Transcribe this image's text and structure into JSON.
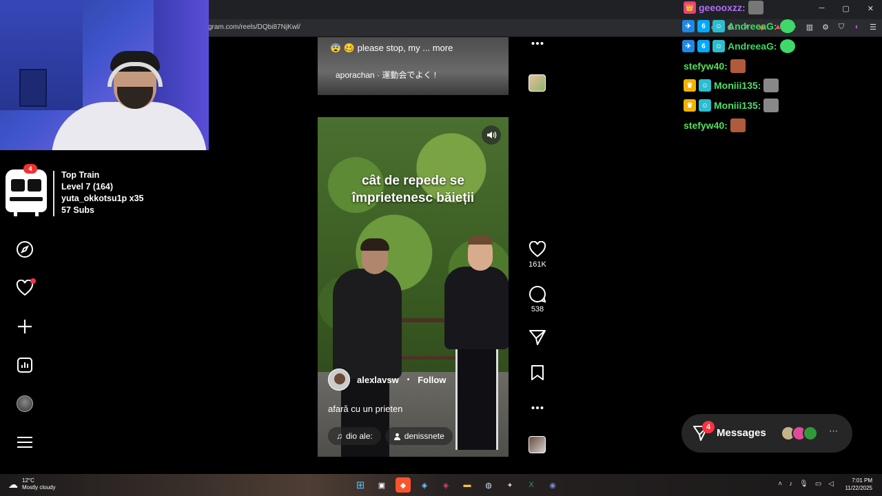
{
  "browser": {
    "url": "gram.com/reels/DQbi87NjKwl/"
  },
  "streamer_widget": {
    "title": "Top Train",
    "level": "Level 7  (164)",
    "top_user": "yuta_okkotsu1p x35",
    "subs": "57 Subs",
    "badge": "4"
  },
  "sidebar": {
    "items": [
      "explore-icon",
      "notifications-icon",
      "create-icon",
      "dashboard-icon",
      "profile-icon",
      "menu-icon"
    ]
  },
  "prev_reel": {
    "caption": "😨 🥴 please stop, my ... more",
    "music": "aporachan · 運動会でよく !"
  },
  "reel": {
    "headline_line1": "cât de repede se",
    "headline_line2": "împrietenesc băieții",
    "author": "alexlavsw",
    "follow": "Follow",
    "caption": "afară cu un prieten",
    "music": "dio  ale:",
    "tagged": "denissnete"
  },
  "actions": {
    "likes": "161K",
    "comments": "538"
  },
  "chat": [
    {
      "user": "geeooxzz:",
      "color": "#b06ef7"
    },
    {
      "user": "AndreeaG:",
      "color": "#3fd86a"
    },
    {
      "user": "AndreeaG:",
      "color": "#3fd86a"
    },
    {
      "user": "stefyw40:",
      "color": "#54e05a"
    },
    {
      "user": "Moniii135:",
      "color": "#4fe06b"
    },
    {
      "user": "Moniii135:",
      "color": "#4fe06b"
    },
    {
      "user": "stefyw40:",
      "color": "#54e05a"
    }
  ],
  "messages": {
    "label": "Messages",
    "badge": "4"
  },
  "taskbar": {
    "temp": "12°C",
    "weather": "Mostly cloudy",
    "time": "7:01 PM",
    "date": "11/22/2025"
  }
}
